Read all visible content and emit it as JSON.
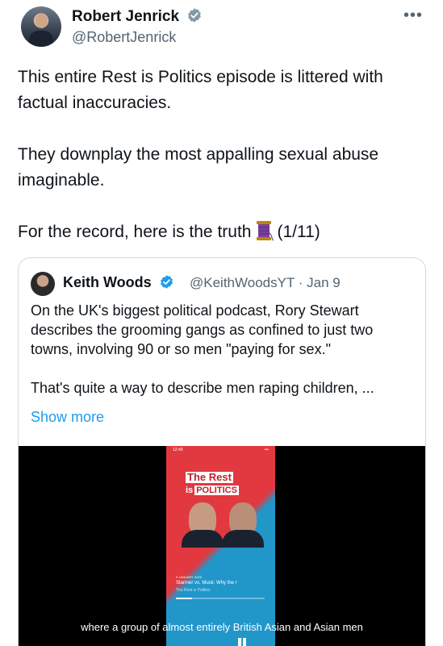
{
  "tweet": {
    "author_name": "Robert Jenrick",
    "author_handle": "@RobertJenrick",
    "more_icon": "more-horizontal-icon",
    "paragraphs": [
      "This entire Rest is Politics episode is littered with factual inaccuracies.",
      "They downplay the most appalling sexual abuse imaginable."
    ],
    "last_line_before": "For the record, here is the truth",
    "last_line_after": "(1/11)",
    "thread_icon": "thread-spool-icon"
  },
  "quoted": {
    "author_name": "Keith Woods",
    "meta": "@KeithWoodsYT · Jan 9",
    "paragraphs": [
      "On the UK's biggest political podcast, Rory Stewart describes the grooming gangs as confined to just two towns, involving 90 or so men \"paying for sex.\"",
      "That's quite a way to describe men raping children, ..."
    ],
    "show_more": "Show more",
    "video": {
      "caption": "where a group of almost entirely British Asian and Asian men",
      "phone": {
        "time": "12:49",
        "status_icons": "•••",
        "logo_line1": "The Rest",
        "logo_is": "is",
        "logo_line2": "POLITICS",
        "episode_date": "9 JANUARY 2025",
        "episode_title": "Starmer vs. Musk: Why the r",
        "episode_show": "The Rest is Politics",
        "progress": 0.18
      }
    }
  },
  "colors": {
    "verified": "#1d9bf0",
    "link": "#1d9bf0",
    "secondary_text": "#536471",
    "podcast_red": "#e2383f",
    "podcast_blue": "#2196c9"
  }
}
